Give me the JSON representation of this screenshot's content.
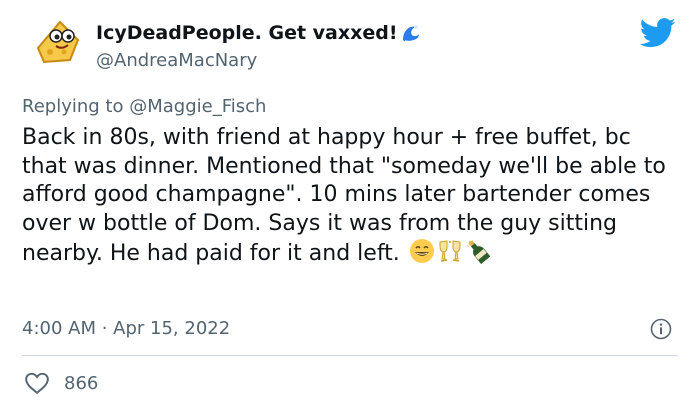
{
  "tweet": {
    "display_name": "IcyDeadPeople. Get vaxxed!",
    "handle": "@AndreaMacNary",
    "replying_prefix": "Replying to",
    "replying_mention": "@Maggie_Fisch",
    "body": "Back in 80s, with friend at happy hour + free buffet, bc that was dinner. Mentioned that \"someday we'll be able to afford good champagne\". 10 mins later bartender comes over w bottle of Dom. Says it was from the guy sitting nearby. He had paid for it and left.",
    "timestamp": "4:00 AM · Apr 15, 2022",
    "like_count": "866"
  },
  "icons": {
    "avatar": "cheese-avatar",
    "name_emoji": "water-wave-icon",
    "brand": "twitter-bird-icon",
    "info": "info-icon",
    "like": "heart-icon",
    "body_emojis": [
      "grinning-face-icon",
      "clinking-glasses-icon",
      "champagne-bottle-icon"
    ]
  },
  "colors": {
    "text_primary": "#0f1419",
    "text_secondary": "#536471",
    "twitter_blue": "#1d9bf0",
    "divider": "#cfd9de"
  }
}
